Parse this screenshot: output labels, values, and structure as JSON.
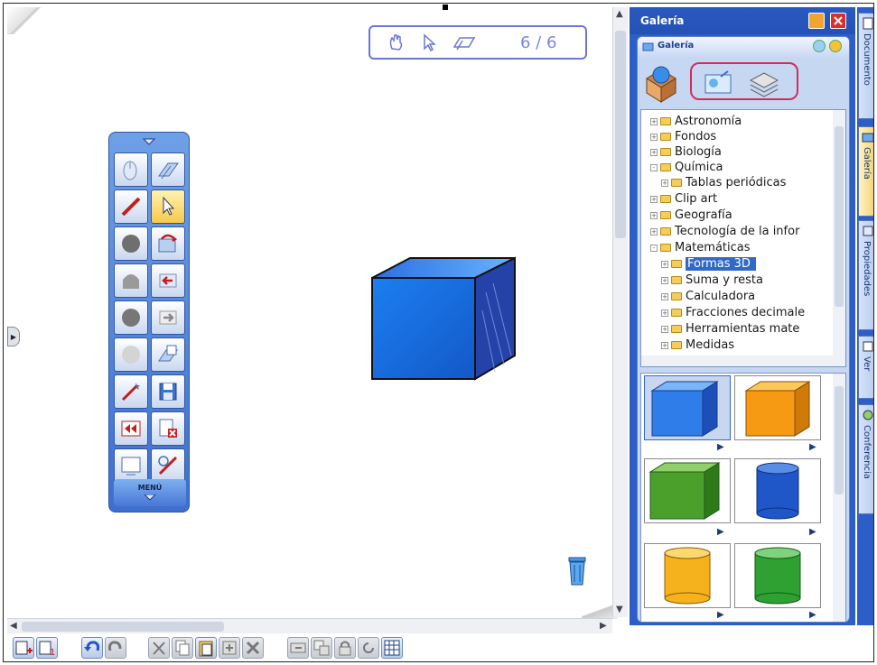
{
  "page_nav": {
    "indicator": "6 / 6"
  },
  "palette": {
    "menu_label": "MENÚ"
  },
  "gallery": {
    "title": "Galería",
    "inner_title": "Galería",
    "tree": [
      {
        "label": "Astronomía",
        "level": 0,
        "expander": "+"
      },
      {
        "label": "Fondos",
        "level": 0,
        "expander": "+"
      },
      {
        "label": "Biología",
        "level": 0,
        "expander": "+"
      },
      {
        "label": "Química",
        "level": 0,
        "expander": "-"
      },
      {
        "label": "Tablas periódicas",
        "level": 1,
        "expander": "+"
      },
      {
        "label": "Clip art",
        "level": 0,
        "expander": "+"
      },
      {
        "label": "Geografía",
        "level": 0,
        "expander": "+"
      },
      {
        "label": "Tecnología de la infor",
        "level": 0,
        "expander": "+"
      },
      {
        "label": "Matemáticas",
        "level": 0,
        "expander": "-"
      },
      {
        "label": "Formas 3D",
        "level": 1,
        "expander": "+",
        "selected": true
      },
      {
        "label": "Suma y resta",
        "level": 1,
        "expander": "+"
      },
      {
        "label": "Calculadora",
        "level": 1,
        "expander": "+"
      },
      {
        "label": "Fracciones decimale",
        "level": 1,
        "expander": "+"
      },
      {
        "label": "Herramientas mate",
        "level": 1,
        "expander": "+"
      },
      {
        "label": "Medidas",
        "level": 1,
        "expander": "+"
      }
    ],
    "thumbnails": [
      {
        "shape": "cube",
        "color": "#2f7de8",
        "selected": true
      },
      {
        "shape": "cube",
        "color": "#f59a12"
      },
      {
        "shape": "cube",
        "color": "#4aa02a"
      },
      {
        "shape": "cylinder",
        "color": "#1f57c8"
      },
      {
        "shape": "cylinder",
        "color": "#f5b21c"
      },
      {
        "shape": "cylinder",
        "color": "#2fa032"
      }
    ]
  },
  "side_tabs": [
    {
      "label": "Documento"
    },
    {
      "label": "Galería",
      "active": true
    },
    {
      "label": "Propiedades"
    },
    {
      "label": "Ver"
    },
    {
      "label": "Conferencia"
    }
  ]
}
